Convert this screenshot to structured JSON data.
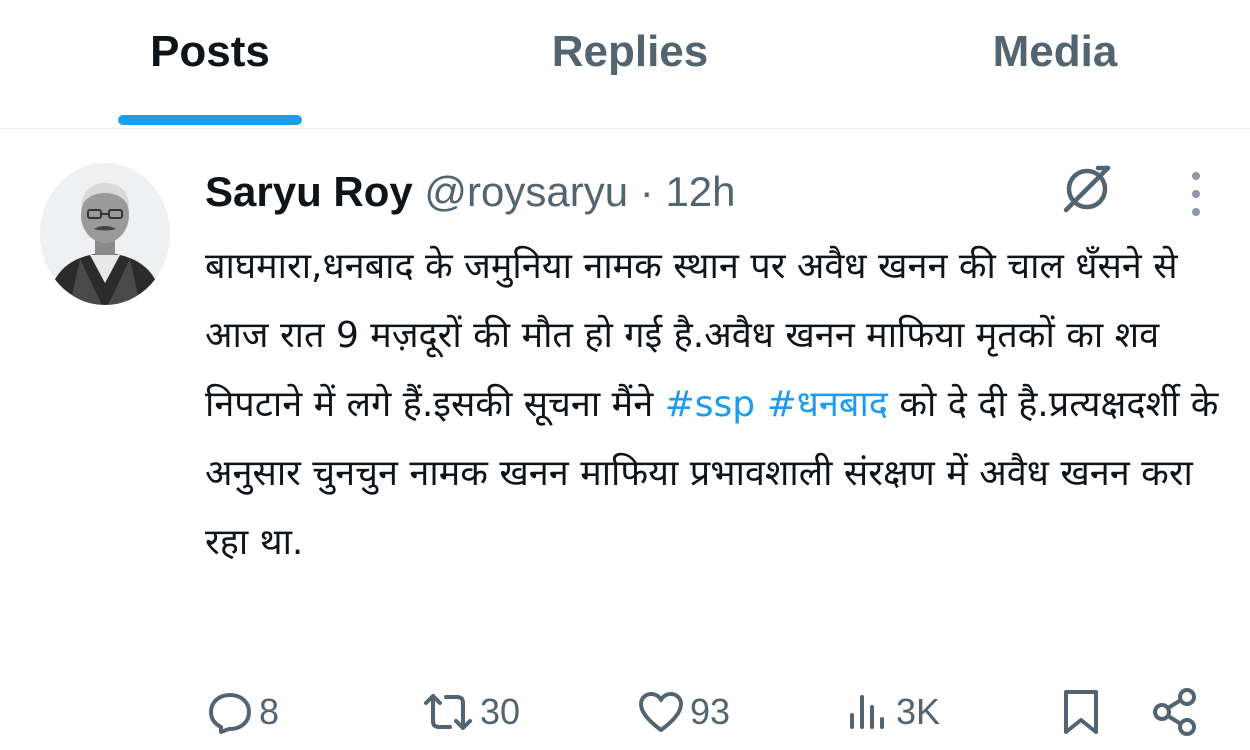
{
  "tabs": [
    {
      "label": "Posts",
      "active": true
    },
    {
      "label": "Replies",
      "active": false
    },
    {
      "label": "Media",
      "active": false
    }
  ],
  "accent_color": "#1d9bf0",
  "tweet": {
    "author_name": "Saryu Roy",
    "handle": "@roysaryu",
    "separator": "·",
    "time": "12h",
    "text": {
      "part1": "बाघमारा,धनबाद के जमुनिया नामक स्थान पर अवैध खनन की चाल धँसने से आज रात 9 मज़दूरों की मौत हो गई है.अवैध खनन माफिया मृतकों का शव निपटाने में लगे हैं.इसकी सूचना मैंने ",
      "hashtag1": "#ssp",
      "hashtag2": "#धनबाद",
      "part2": " को दे दी है.प्रत्यक्षदर्शी के अनुसार चुनचुन नामक खनन माफिया प्रभावशाली संरक्षण में अवैध खनन करा रहा था."
    },
    "icons": {
      "grok": "grok-icon",
      "more": "more-vertical-icon"
    }
  },
  "actions": {
    "replies": "8",
    "reposts": "30",
    "likes": "93",
    "views": "3K",
    "icons": [
      "reply-icon",
      "repost-icon",
      "like-icon",
      "views-icon",
      "bookmark-icon",
      "share-icon"
    ]
  }
}
